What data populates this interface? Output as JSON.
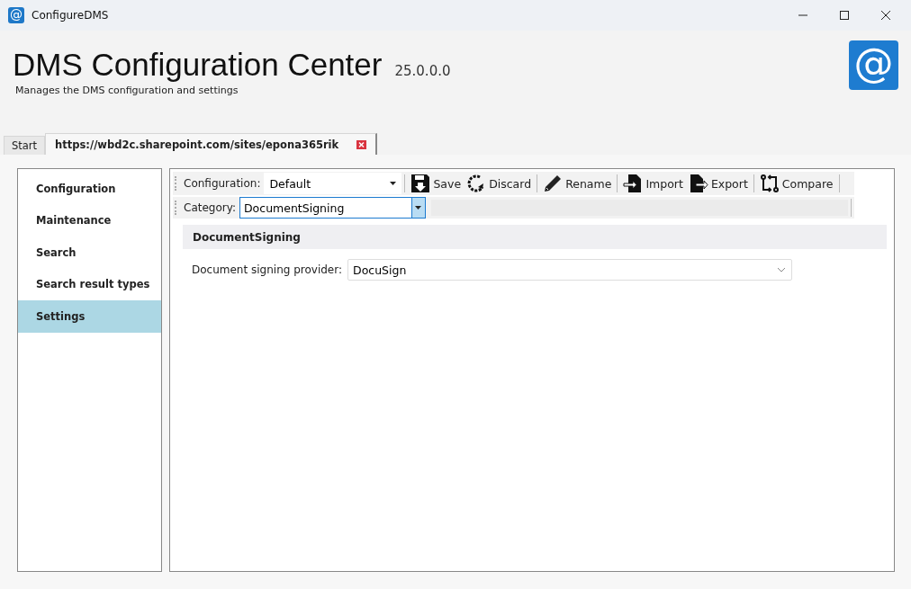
{
  "window": {
    "icon": "@",
    "title": "ConfigureDMS"
  },
  "header": {
    "title": "DMS Configuration Center",
    "version": "25.0.0.0",
    "subtitle": "Manages the DMS configuration and settings",
    "logo": "@"
  },
  "tabs": [
    {
      "label": "Start",
      "selected": false,
      "closable": false
    },
    {
      "label": "https://wbd2c.sharepoint.com/sites/epona365rik",
      "selected": true,
      "closable": true
    }
  ],
  "sidebar": {
    "items": [
      {
        "label": "Configuration",
        "selected": false
      },
      {
        "label": "Maintenance",
        "selected": false
      },
      {
        "label": "Search",
        "selected": false
      },
      {
        "label": "Search result types",
        "selected": false
      },
      {
        "label": "Settings",
        "selected": true
      }
    ]
  },
  "toolbar": {
    "configuration_label": "Configuration:",
    "configuration_value": "Default",
    "buttons": [
      {
        "kind": "save",
        "label": "Save"
      },
      {
        "kind": "discard",
        "label": "Discard"
      },
      {
        "kind": "rename",
        "label": "Rename"
      },
      {
        "kind": "import",
        "label": "Import"
      },
      {
        "kind": "export",
        "label": "Export"
      },
      {
        "kind": "compare",
        "label": "Compare"
      }
    ],
    "category_label": "Category:",
    "category_value": "DocumentSigning"
  },
  "section": {
    "title": "DocumentSigning",
    "fields": [
      {
        "label": "Document signing provider:",
        "value": "DocuSign"
      }
    ]
  }
}
